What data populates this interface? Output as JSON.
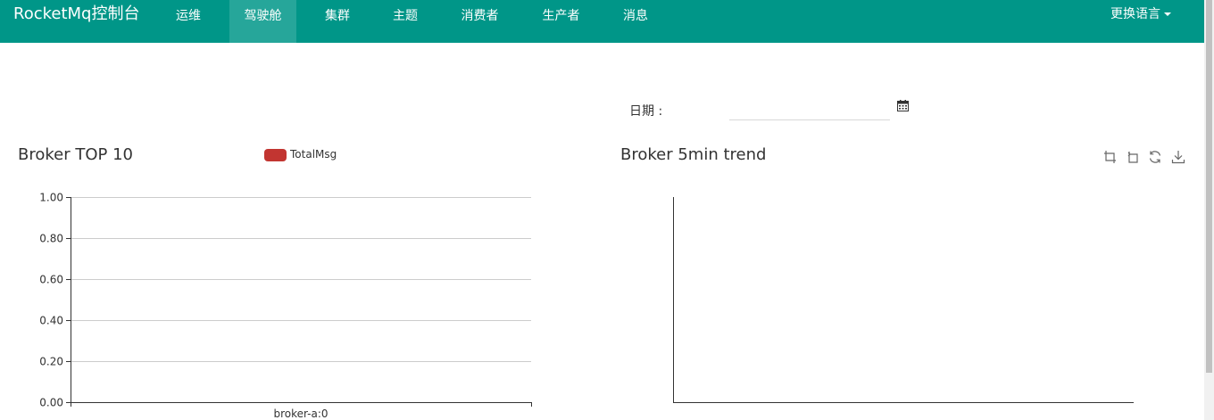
{
  "navbar": {
    "brand": "RocketMq控制台",
    "items": [
      {
        "label": "运维"
      },
      {
        "label": "驾驶舱",
        "active": true
      },
      {
        "label": "集群"
      },
      {
        "label": "主题"
      },
      {
        "label": "消费者"
      },
      {
        "label": "生产者"
      },
      {
        "label": "消息"
      }
    ],
    "language": "更换语言",
    "color": "#009688"
  },
  "filter": {
    "date_label": "日期 :",
    "date_value": "",
    "icon": "calendar-icon"
  },
  "top10": {
    "title": "Broker TOP 10",
    "legend_label": "TotalMsg"
  },
  "trend": {
    "title": "Broker 5min trend",
    "toolbox": [
      "zoom-icon",
      "zoom-reset-icon",
      "restore-icon",
      "save-image-icon"
    ]
  },
  "chart_data": [
    {
      "type": "bar",
      "title": "Broker TOP 10",
      "categories": [
        "broker-a:0"
      ],
      "series": [
        {
          "name": "TotalMsg",
          "values": [
            0
          ],
          "color": "#c23531"
        }
      ],
      "ylim": [
        0,
        1
      ],
      "yticks": [
        "0.00",
        "0.20",
        "0.40",
        "0.60",
        "0.80",
        "1.00"
      ],
      "grid": true,
      "legend": "top-center"
    },
    {
      "type": "line",
      "title": "Broker 5min trend",
      "series": [],
      "grid": false
    }
  ]
}
